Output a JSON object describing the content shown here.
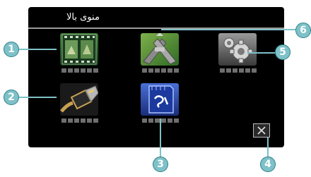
{
  "header": {
    "title": "منوی بالا"
  },
  "tiles": [
    {
      "name": "video-playback-tile",
      "icon": "film-strip-icon"
    },
    {
      "name": "merge-tile",
      "icon": "merge-arrows-icon"
    },
    {
      "name": "settings-tile",
      "icon": "gears-icon"
    },
    {
      "name": "hdmi-output-tile",
      "icon": "hdmi-cable-icon"
    },
    {
      "name": "sd-card-tile",
      "icon": "sd-card-icon"
    }
  ],
  "close_button": {
    "icon": "close-icon"
  },
  "callouts": [
    "1",
    "2",
    "3",
    "4",
    "5",
    "6"
  ],
  "colors": {
    "callout": "#7ec1c8",
    "screen": "#000000",
    "placeholder": "#6e6e6e"
  }
}
